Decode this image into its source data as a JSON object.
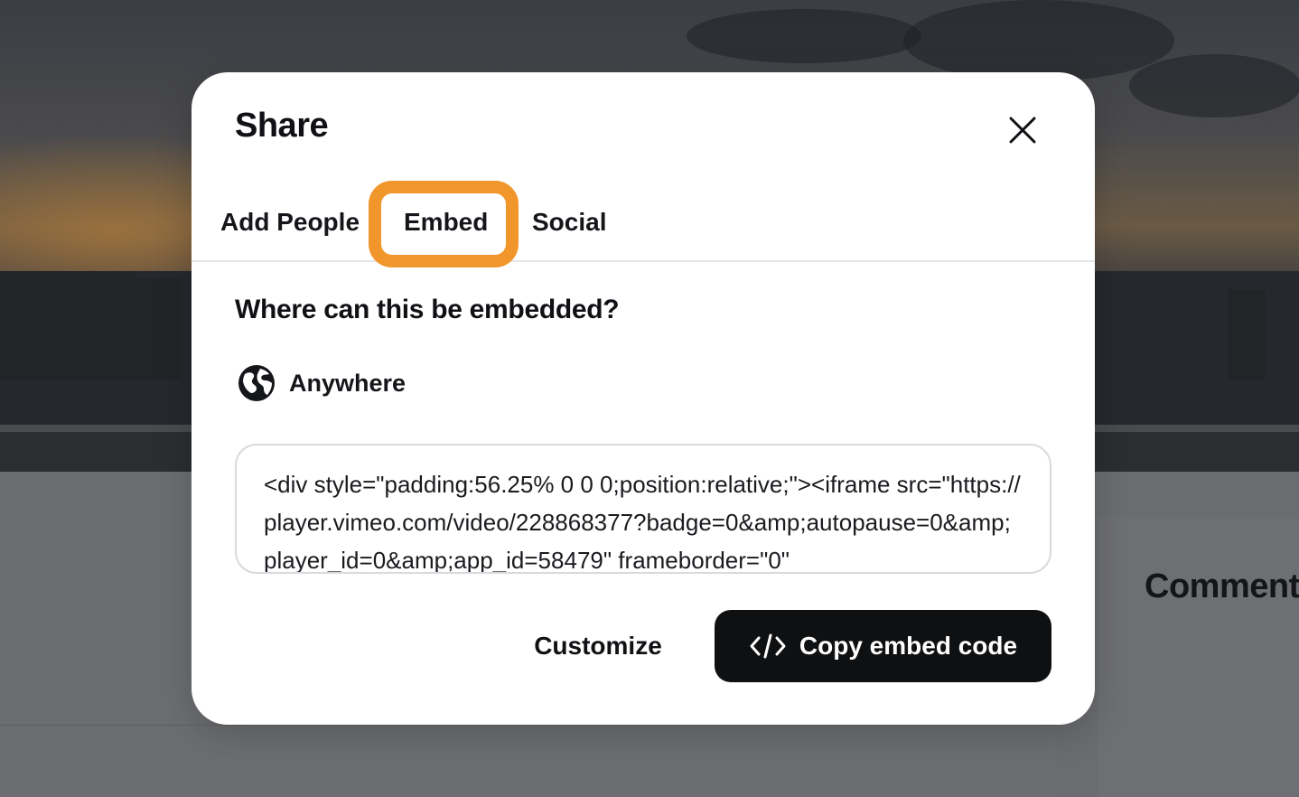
{
  "modal": {
    "title": "Share",
    "tabs": [
      {
        "label": "Add People",
        "selected": false
      },
      {
        "label": "Embed",
        "selected": true
      },
      {
        "label": "Social",
        "selected": false
      }
    ],
    "embed": {
      "question": "Where can this be embedded?",
      "option_label": "Anywhere",
      "option_icon": "globe-icon",
      "code": "<div style=\"padding:56.25% 0 0 0;position:relative;\"><iframe src=\"https://player.vimeo.com/video/228868377?badge=0&amp;autopause=0&amp;player_id=0&amp;app_id=58479\" frameborder=\"0\""
    },
    "actions": {
      "customize_label": "Customize",
      "copy_label": "Copy embed code",
      "copy_icon": "code-icon"
    },
    "close_icon": "close-icon"
  },
  "background": {
    "comments_heading": "Comment"
  },
  "colors": {
    "highlight_ring": "#f0962b",
    "primary_button": "#0f1012",
    "overlay": "#67686b"
  }
}
